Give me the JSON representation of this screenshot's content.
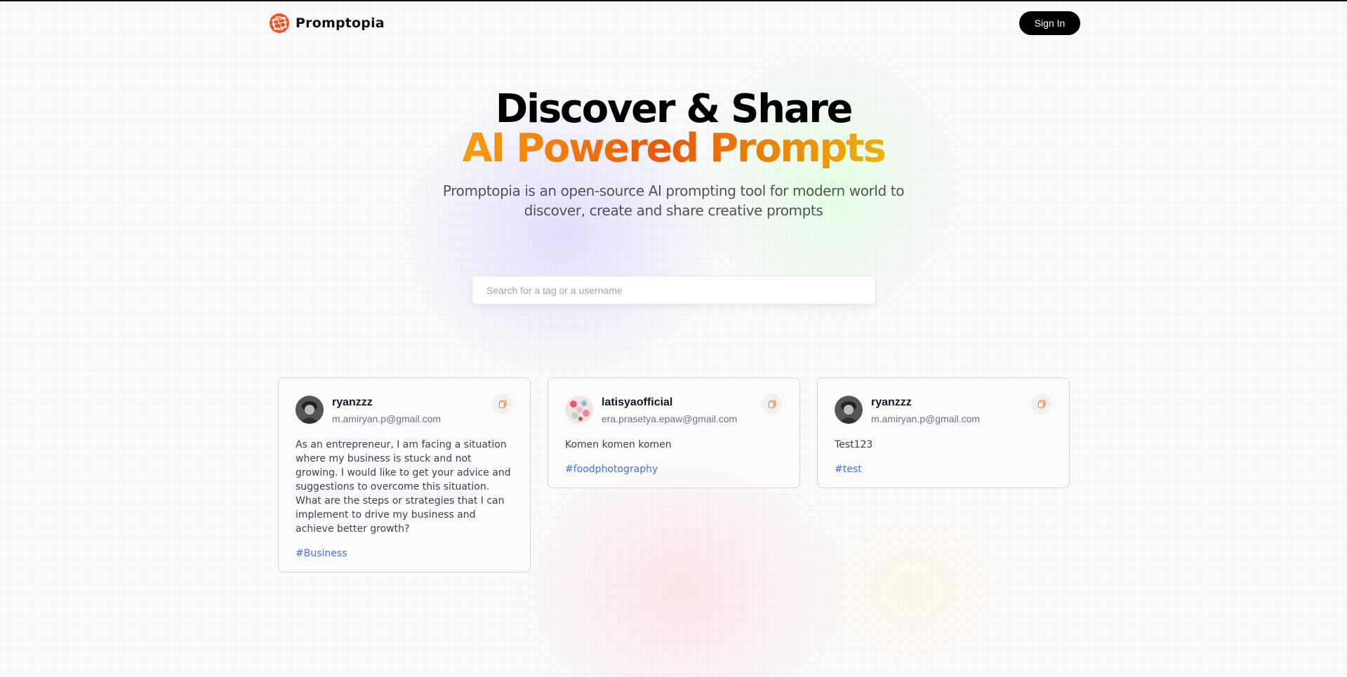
{
  "header": {
    "brand_name": "Promptopia",
    "signin_label": "Sign In"
  },
  "hero": {
    "title_line1": "Discover & Share",
    "title_line2": "AI Powered Prompts",
    "subtitle": "Promptopia is an open-source AI prompting tool for modern world to discover, create and share creative prompts"
  },
  "search": {
    "placeholder": "Search for a tag or a username",
    "value": ""
  },
  "prompts": [
    {
      "username": "ryanzzz",
      "email": "m.amiryan.p@gmail.com",
      "prompt": "As an entrepreneur, I am facing a situation where my business is stuck and not growing. I would like to get your advice and suggestions to overcome this situation. What are the steps or strategies that I can implement to drive my business and achieve better growth?",
      "tag": "#Business",
      "avatar_icon": "user-photo-dark"
    },
    {
      "username": "latisyaofficial",
      "email": "era.prasetya.epaw@gmail.com",
      "prompt": "Komen komen komen",
      "tag": "#foodphotography",
      "avatar_icon": "user-photo-floral"
    },
    {
      "username": "ryanzzz",
      "email": "m.amiryan.p@gmail.com",
      "prompt": "Test123",
      "tag": "#test",
      "avatar_icon": "user-photo-dark"
    }
  ],
  "colors": {
    "accent_orange": "#f97316",
    "tag_blue": "#2563eb",
    "gradient_start": "#f59e0b",
    "gradient_mid": "#ea580c",
    "gradient_end": "#eab308"
  }
}
